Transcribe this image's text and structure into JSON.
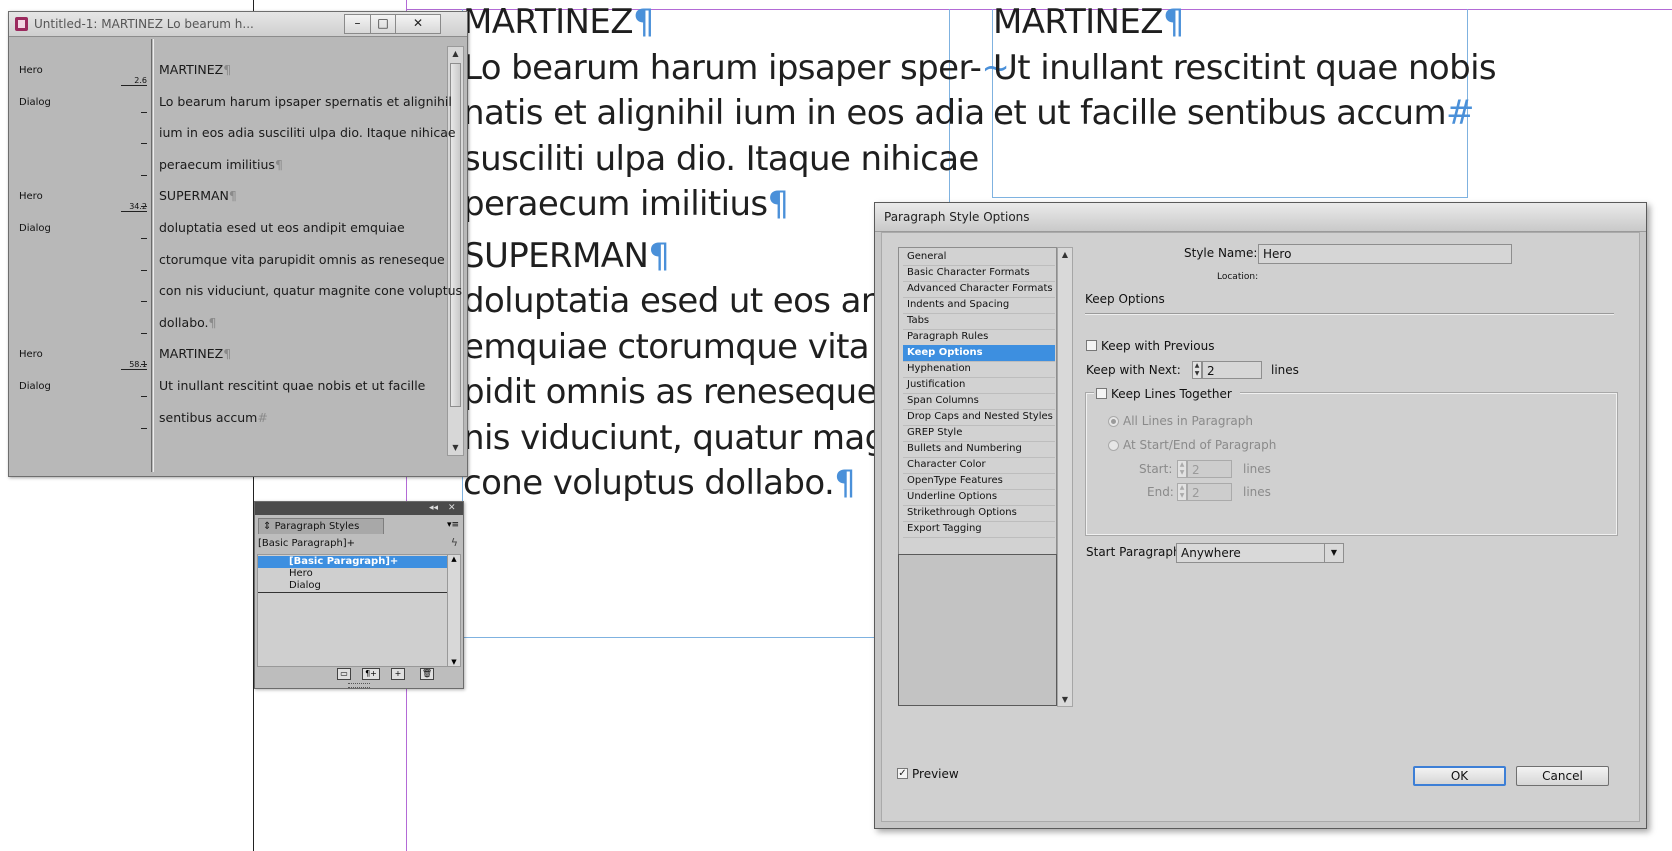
{
  "layout": {
    "frame1": {
      "lines": [
        {
          "text": "MARTINEZ",
          "end": "¶"
        },
        {
          "text": "Lo bearum harum ipsaper sper-",
          "end": "~"
        },
        {
          "text": "natis et alignihil ium in eos adia",
          "end": ""
        },
        {
          "text": "susciliti ulpa dio. Itaque nihicae",
          "end": ""
        },
        {
          "text": "peraecum imilitius",
          "end": "¶"
        },
        {
          "text": "SUPERMAN",
          "end": "¶"
        },
        {
          "text": "doluptatia esed ut eos an",
          "end": ""
        },
        {
          "text": "emquiae ctorumque vita",
          "end": ""
        },
        {
          "text": "pidit omnis as reneseque",
          "end": ""
        },
        {
          "text": "nis viduciunt, quatur mag",
          "end": ""
        },
        {
          "text": "cone voluptus dollabo.",
          "end": "¶"
        }
      ]
    },
    "frame2": {
      "lines": [
        {
          "text": "MARTINEZ",
          "end": "¶"
        },
        {
          "text": "Ut inullant rescitint quae nobis",
          "end": ""
        },
        {
          "text": "et ut facille sentibus accum",
          "end": "#"
        }
      ]
    }
  },
  "story_editor": {
    "title": "Untitled-1: MARTINEZ Lo bearum h...",
    "buttons": {
      "minimize": "–",
      "maximize": "□",
      "close": "✕"
    },
    "style_tags": [
      {
        "label": "Hero"
      },
      {
        "label": "Dialog"
      },
      {
        "label": "Hero"
      },
      {
        "label": "Dialog"
      },
      {
        "label": "Hero"
      },
      {
        "label": "Dialog"
      }
    ],
    "depth_marks": [
      "2.6",
      "34.2",
      "58.1"
    ],
    "lines": [
      {
        "text": "MARTINEZ",
        "end": "¶"
      },
      {
        "text": "Lo bearum harum ipsaper spernatis et alignihil",
        "end": ""
      },
      {
        "text": "ium in eos adia susciliti ulpa dio. Itaque nihicae",
        "end": ""
      },
      {
        "text": "peraecum imilitius",
        "end": "¶"
      },
      {
        "text": "SUPERMAN",
        "end": "¶"
      },
      {
        "text": "doluptatia esed ut eos andipit emquiae",
        "end": ""
      },
      {
        "text": "ctorumque vita parupidit omnis as reneseque",
        "end": ""
      },
      {
        "text": "con nis viduciunt, quatur magnite cone voluptus",
        "end": ""
      },
      {
        "text": "dollabo.",
        "end": "¶"
      },
      {
        "text": "MARTINEZ",
        "end": "¶"
      },
      {
        "text": "Ut inullant rescitint quae nobis et ut facille",
        "end": ""
      },
      {
        "text": "sentibus accum",
        "end": "#"
      }
    ]
  },
  "paragraph_styles_panel": {
    "tab_label": "Paragraph Styles",
    "current_style": "[Basic Paragraph]+",
    "items": [
      "[Basic Paragraph]+",
      "Hero",
      "Dialog"
    ],
    "selected_index": 0
  },
  "dialog": {
    "title": "Paragraph Style Options",
    "categories": [
      "General",
      "Basic Character Formats",
      "Advanced Character Formats",
      "Indents and Spacing",
      "Tabs",
      "Paragraph Rules",
      "Keep Options",
      "Hyphenation",
      "Justification",
      "Span Columns",
      "Drop Caps and Nested Styles",
      "GREP Style",
      "Bullets and Numbering",
      "Character Color",
      "OpenType Features",
      "Underline Options",
      "Strikethrough Options",
      "Export Tagging"
    ],
    "selected_category": "Keep Options",
    "style_name_label": "Style Name:",
    "style_name_value": "Hero",
    "location_label": "Location:",
    "section_title": "Keep Options",
    "keep_with_previous": {
      "label": "Keep with Previous",
      "checked": false
    },
    "keep_with_next": {
      "label": "Keep with Next:",
      "value": "2",
      "unit": "lines"
    },
    "keep_lines_together": {
      "label": "Keep Lines Together",
      "checked": false
    },
    "all_lines": {
      "label": "All Lines in Paragraph",
      "selected": true
    },
    "at_start_end": {
      "label": "At Start/End of Paragraph",
      "selected": false
    },
    "start": {
      "label": "Start:",
      "value": "2",
      "unit": "lines"
    },
    "end": {
      "label": "End:",
      "value": "2",
      "unit": "lines"
    },
    "start_paragraph": {
      "label": "Start Paragraph:",
      "value": "Anywhere"
    },
    "preview": {
      "label": "Preview",
      "checked": true
    },
    "ok_label": "OK",
    "cancel_label": "Cancel"
  },
  "colors": {
    "pilcrow": "#4a90d9",
    "selection": "#3d8fe0",
    "frame_edge": "#7fb2e0",
    "margin_guide": "#b36ad6"
  }
}
